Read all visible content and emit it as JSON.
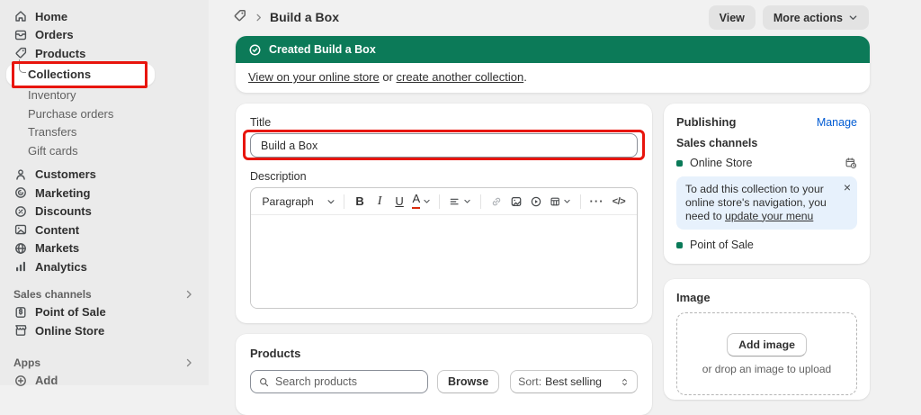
{
  "colors": {
    "banner_green": "#0c7a58",
    "link_blue": "#005bd3",
    "info_bg": "#e7f1fc",
    "annotation_red": "#e8150d",
    "channel_dot": "#0a7a58",
    "sidebar_bg": "#ebebeb",
    "page_bg": "#f1f1f1"
  },
  "sidebar": {
    "items": [
      {
        "label": "Home"
      },
      {
        "label": "Orders"
      },
      {
        "label": "Products"
      },
      {
        "label": "Collections",
        "state": "active"
      },
      {
        "label": "Inventory"
      },
      {
        "label": "Purchase orders"
      },
      {
        "label": "Transfers"
      },
      {
        "label": "Gift cards"
      },
      {
        "label": "Customers"
      },
      {
        "label": "Marketing"
      },
      {
        "label": "Discounts"
      },
      {
        "label": "Content"
      },
      {
        "label": "Markets"
      },
      {
        "label": "Analytics"
      }
    ],
    "sections": [
      {
        "heading": "Sales channels",
        "items": [
          {
            "label": "Point of Sale"
          },
          {
            "label": "Online Store"
          }
        ]
      },
      {
        "heading": "Apps",
        "items": [
          {
            "label": "Add"
          }
        ]
      }
    ]
  },
  "header": {
    "breadcrumb_title": "Build a Box",
    "view_label": "View",
    "more_actions_label": "More actions"
  },
  "banner": {
    "title": "Created Build a Box",
    "link_store": "View on your online store",
    "conjunction": " or ",
    "link_create": "create another collection",
    "period": "."
  },
  "title_section": {
    "label": "Title",
    "value": "Build a Box"
  },
  "description_section": {
    "label": "Description",
    "toolbar": {
      "paragraph_label": "Paragraph",
      "bold": "B",
      "italic": "I",
      "underline": "U",
      "text_color": "A",
      "more_dots": "···",
      "code": "</>"
    }
  },
  "products_section": {
    "heading": "Products",
    "search_placeholder": "Search products",
    "browse_label": "Browse",
    "sort_prefix": "Sort:",
    "sort_value": "Best selling"
  },
  "publishing": {
    "heading": "Publishing",
    "manage_label": "Manage",
    "subheading": "Sales channels",
    "channels": [
      {
        "label": "Online Store"
      },
      {
        "label": "Point of Sale"
      }
    ],
    "info_text": "To add this collection to your online store's navigation, you need to ",
    "info_link": "update your menu",
    "close_glyph": "×"
  },
  "image_section": {
    "heading": "Image",
    "add_button_label": "Add image",
    "drop_hint": "or drop an image to upload"
  }
}
